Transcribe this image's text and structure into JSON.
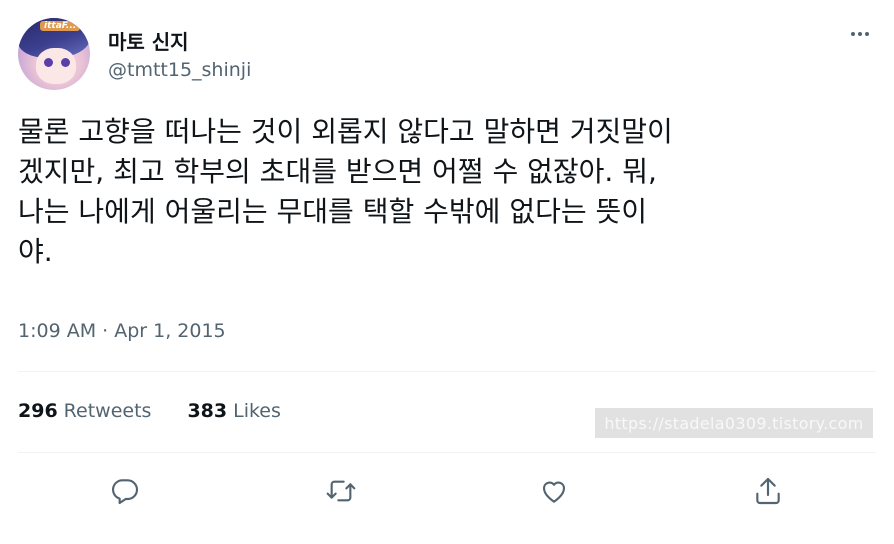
{
  "user": {
    "display_name": "마토 신지",
    "handle": "@tmtt15_shinji",
    "avatar_badge": "ittaF..."
  },
  "tweet": {
    "text": "물론 고향을 떠나는 것이 외롭지 않다고 말하면 거짓말이\n겠지만, 최고 학부의 초대를 받으면 어쩔 수 없잖아. 뭐,\n나는 나에게 어울리는 무대를 택할 수밖에 없다는 뜻이\n야.",
    "timestamp": "1:09 AM · Apr 1, 2015"
  },
  "stats": {
    "retweets_count": "296",
    "retweets_label": "Retweets",
    "likes_count": "383",
    "likes_label": "Likes"
  },
  "watermark": "https://stadela0309.tistory.com",
  "actions": {
    "reply_icon": "reply-icon",
    "retweet_icon": "retweet-icon",
    "like_icon": "like-icon",
    "share_icon": "share-icon",
    "icon_color": "#536471"
  }
}
